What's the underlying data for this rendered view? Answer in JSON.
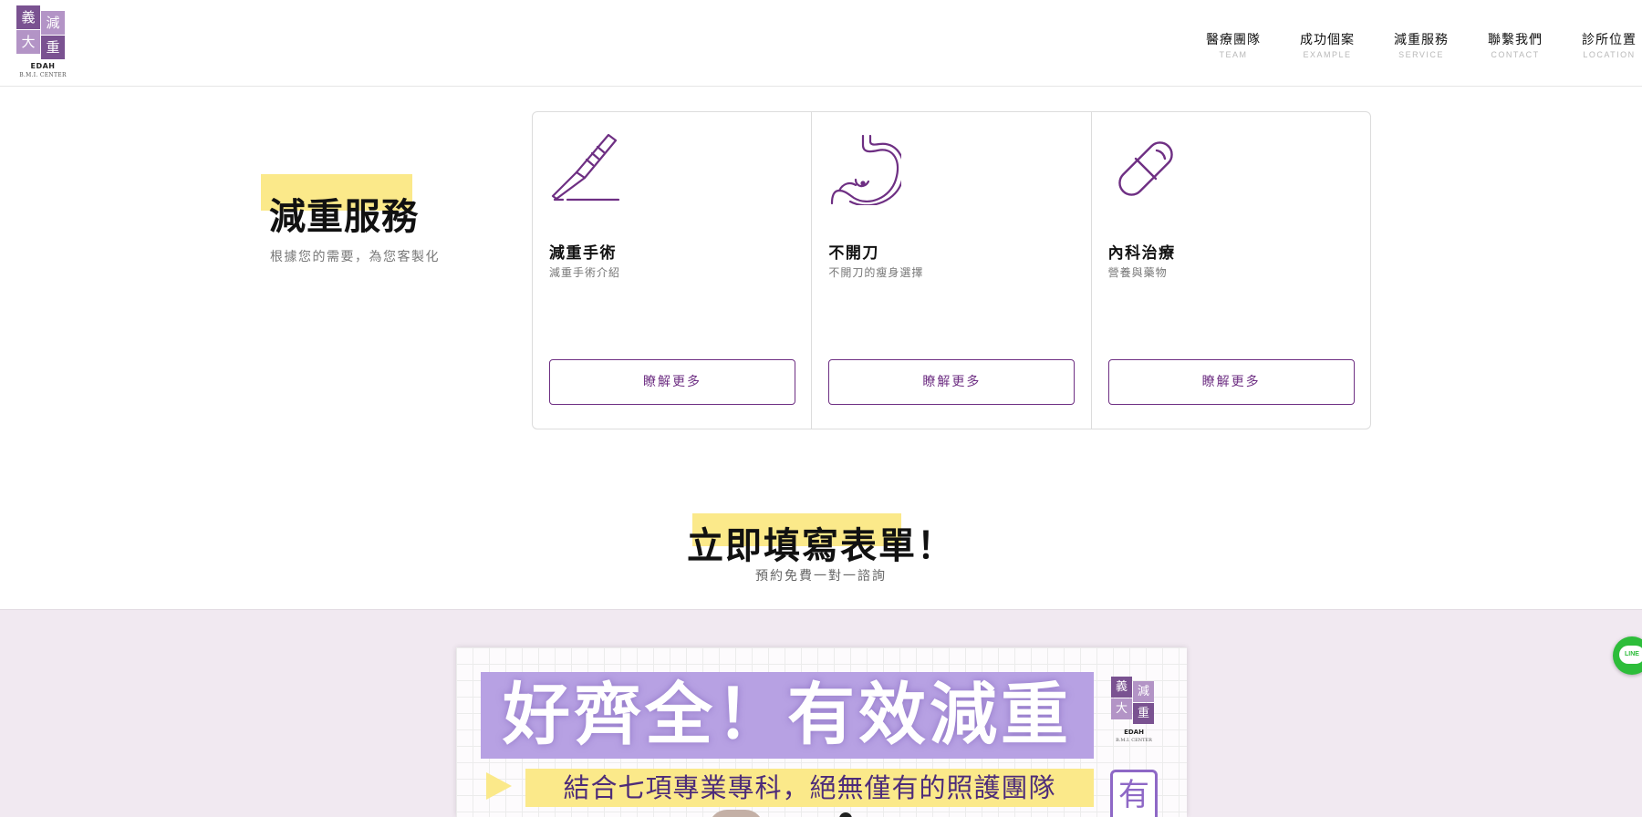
{
  "logo": {
    "chars": [
      "義",
      "減",
      "大",
      "重"
    ],
    "name": "EDAH",
    "tagline": "B.M.I. CENTER"
  },
  "nav": [
    {
      "zh": "醫療團隊",
      "en": "TEAM"
    },
    {
      "zh": "成功個案",
      "en": "EXAMPLE"
    },
    {
      "zh": "減重服務",
      "en": "SERVICE"
    },
    {
      "zh": "聯繫我們",
      "en": "CONTACT"
    },
    {
      "zh": "診所位置",
      "en": "LOCATION"
    }
  ],
  "services": {
    "title": "減重服務",
    "subtitle": "根據您的需要，為您客製化",
    "cards": [
      {
        "icon": "scalpel-icon",
        "title": "減重手術",
        "subtitle": "減重手術介紹",
        "button": "瞭解更多"
      },
      {
        "icon": "stomach-icon",
        "title": "不開刀",
        "subtitle": "不開刀的瘦身選擇",
        "button": "瞭解更多"
      },
      {
        "icon": "pill-icon",
        "title": "內科治療",
        "subtitle": "營養與藥物",
        "button": "瞭解更多"
      }
    ]
  },
  "form": {
    "title": "立即填寫表單！",
    "subtitle": "預約免費一對一諮詢"
  },
  "banner": {
    "headline": "好齊全！有效減重",
    "subline": "結合七項專業專科，絕無僅有的照護團隊",
    "tag": "有"
  },
  "floating": {
    "line_label": "LINE"
  },
  "colors": {
    "accent": "#6e2f83",
    "highlight": "#fbe98a",
    "band": "#f1e9f1",
    "banner_head": "#b7a1e3"
  }
}
